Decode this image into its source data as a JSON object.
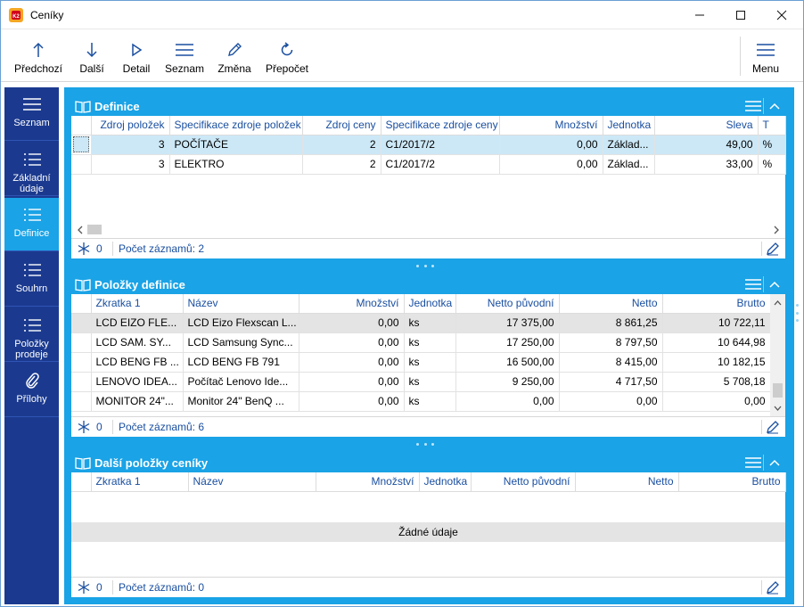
{
  "window": {
    "title": "Ceníky",
    "minimize": "—",
    "maximize": "☐",
    "close": "✕"
  },
  "toolbar": {
    "prev": "Předchozí",
    "next": "Další",
    "detail": "Detail",
    "list": "Seznam",
    "edit": "Změna",
    "recalc": "Přepočet",
    "menu": "Menu"
  },
  "sidebar": {
    "items": [
      {
        "label": "Seznam"
      },
      {
        "label": "Základní údaje"
      },
      {
        "label": "Definice"
      },
      {
        "label": "Souhrn"
      },
      {
        "label": "Položky prodeje"
      },
      {
        "label": "Přílohy"
      }
    ],
    "active": "Definice"
  },
  "colors": {
    "accent": "#1aa3e6",
    "sidebar": "#1b3a8f",
    "header_text": "#1a4fa0",
    "selected_row": "#cce8f7"
  },
  "definice": {
    "title": "Definice",
    "columns": [
      "Zdroj položek",
      "Specifikace zdroje položek",
      "Zdroj ceny",
      "Specifikace zdroje ceny",
      "Množství",
      "Jednotka",
      "Sleva",
      "T"
    ],
    "rows": [
      [
        "3",
        "POČÍTAČE",
        "2",
        "C1/2017/2",
        "0,00",
        "Základ...",
        "49,00",
        "%"
      ],
      [
        "3",
        "ELEKTRO",
        "2",
        "C1/2017/2",
        "0,00",
        "Základ...",
        "33,00",
        "%"
      ]
    ],
    "footer": {
      "count": "0",
      "records": "Počet záznamů: 2"
    }
  },
  "polozky": {
    "title": "Položky definice",
    "columns": [
      "Zkratka 1",
      "Název",
      "Množství",
      "Jednotka",
      "Netto původní",
      "Netto",
      "Brutto"
    ],
    "rows": [
      [
        "LCD EIZO FLE...",
        "LCD Eizo Flexscan L...",
        "0,00",
        "ks",
        "17 375,00",
        "8 861,25",
        "10 722,11"
      ],
      [
        "LCD SAM. SY...",
        "LCD Samsung Sync...",
        "0,00",
        "ks",
        "17 250,00",
        "8 797,50",
        "10 644,98"
      ],
      [
        "LCD BENG FB ...",
        "LCD BENG FB 791",
        "0,00",
        "ks",
        "16 500,00",
        "8 415,00",
        "10 182,15"
      ],
      [
        "LENOVO IDEA...",
        "Počítač Lenovo Ide...",
        "0,00",
        "ks",
        "9 250,00",
        "4 717,50",
        "5 708,18"
      ],
      [
        "MONITOR 24\"...",
        "Monitor 24\" BenQ ...",
        "0,00",
        "ks",
        "0,00",
        "0,00",
        "0,00"
      ]
    ],
    "footer": {
      "count": "0",
      "records": "Počet záznamů: 6"
    }
  },
  "dalsi": {
    "title": "Další položky ceníky",
    "columns": [
      "Zkratka 1",
      "Název",
      "Množství",
      "Jednotka",
      "Netto původní",
      "Netto",
      "Brutto"
    ],
    "nodata": "Žádné údaje",
    "footer": {
      "count": "0",
      "records": "Počet záznamů: 0"
    }
  }
}
